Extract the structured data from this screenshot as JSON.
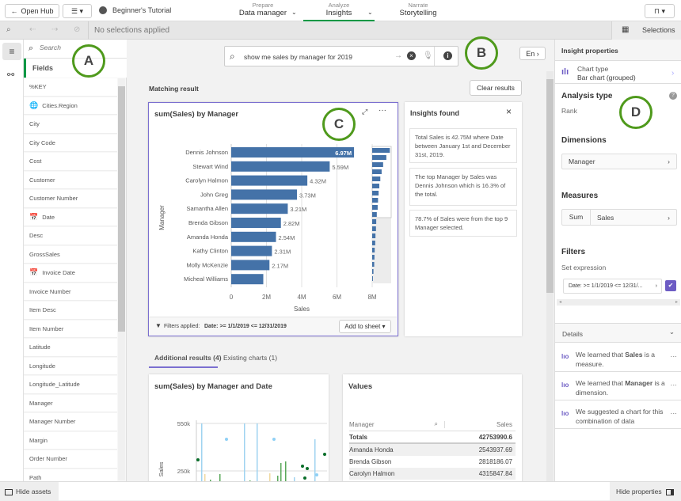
{
  "header": {
    "open_hub": "Open Hub",
    "app_name": "Beginner's Tutorial",
    "tabs": [
      {
        "small": "Prepare",
        "label": "Data manager"
      },
      {
        "small": "Analyze",
        "label": "Insights"
      },
      {
        "small": "Narrate",
        "label": "Storytelling"
      }
    ]
  },
  "toolbar": {
    "selections_status": "No selections applied",
    "selections_label": "Selections"
  },
  "assets": {
    "search_placeholder": "Search",
    "fields_tab": "Fields",
    "fields": [
      {
        "name": "%KEY",
        "icon": ""
      },
      {
        "name": "Cities.Region",
        "icon": "globe-icon"
      },
      {
        "name": "City",
        "icon": ""
      },
      {
        "name": "City Code",
        "icon": ""
      },
      {
        "name": "Cost",
        "icon": ""
      },
      {
        "name": "Customer",
        "icon": ""
      },
      {
        "name": "Customer Number",
        "icon": ""
      },
      {
        "name": "Date",
        "icon": "calendar-icon"
      },
      {
        "name": "Desc",
        "icon": ""
      },
      {
        "name": "GrossSales",
        "icon": ""
      },
      {
        "name": "Invoice Date",
        "icon": "calendar-icon"
      },
      {
        "name": "Invoice Number",
        "icon": ""
      },
      {
        "name": "Item Desc",
        "icon": ""
      },
      {
        "name": "Item Number",
        "icon": ""
      },
      {
        "name": "Latitude",
        "icon": ""
      },
      {
        "name": "Longitude",
        "icon": ""
      },
      {
        "name": "Longitude_Latitude",
        "icon": ""
      },
      {
        "name": "Manager",
        "icon": ""
      },
      {
        "name": "Manager Number",
        "icon": ""
      },
      {
        "name": "Margin",
        "icon": ""
      },
      {
        "name": "Order Number",
        "icon": ""
      },
      {
        "name": "Path",
        "icon": ""
      }
    ],
    "hide_assets": "Hide assets"
  },
  "search": {
    "query": "show me sales by manager for 2019",
    "language": "En"
  },
  "main": {
    "matching_result": "Matching result",
    "clear_results": "Clear results",
    "filters_applied_label": "Filters applied:",
    "filters_applied_value": "Date: >= 1/1/2019 <= 12/31/2019",
    "add_to_sheet": "Add to sheet",
    "tabs": [
      "Additional results (4)",
      "Existing charts (1)"
    ]
  },
  "insights": {
    "title": "Insights found",
    "items": [
      "Total Sales is 42.75M where Date between January 1st and December 31st, 2019.",
      "The top Manager by Sales was Dennis Johnson which is 16.3% of the total.",
      "78.7% of Sales were from the top 9 Manager selected."
    ]
  },
  "annotations": [
    "A",
    "B",
    "C",
    "D"
  ],
  "chart_data": [
    {
      "type": "bar",
      "orientation": "horizontal",
      "title": "sum(Sales) by Manager",
      "xlabel": "Sales",
      "ylabel": "Manager",
      "categories": [
        "Dennis Johnson",
        "Stewart Wind",
        "Carolyn Halmon",
        "John Greg",
        "Samantha Allen",
        "Brenda Gibson",
        "Amanda Honda",
        "Kathy Clinton",
        "Molly McKenzie",
        "Micheal Williams"
      ],
      "values": [
        6.97,
        5.59,
        4.32,
        3.73,
        3.21,
        2.82,
        2.54,
        2.31,
        2.17,
        1.82
      ],
      "labels": [
        "6.97M",
        "5.59M",
        "4.32M",
        "3.73M",
        "3.21M",
        "2.82M",
        "2.54M",
        "2.31M",
        "2.17M",
        ""
      ],
      "xlim": [
        0,
        8
      ],
      "xticks": [
        "0",
        "2M",
        "4M",
        "6M",
        "8M"
      ],
      "color": "#4472a8",
      "grid": true
    },
    {
      "type": "bar",
      "title": "sum(Sales) by Manager and Date",
      "ylabel": "Sales",
      "yticks": [
        "550k",
        "250k"
      ],
      "ylim": [
        0,
        600000
      ]
    },
    {
      "type": "table",
      "title": "Values",
      "columns": [
        "Manager",
        "Sales"
      ],
      "totals": [
        "Totals",
        "42753990.6"
      ],
      "rows": [
        [
          "Amanda Honda",
          "2543937.69"
        ],
        [
          "Brenda Gibson",
          "2818186.07"
        ],
        [
          "Carolyn Halmon",
          "4315847.84"
        ]
      ]
    }
  ],
  "properties": {
    "title": "Insight properties",
    "chart_type_label": "Chart type",
    "chart_type_value": "Bar chart (grouped)",
    "analysis_type_label": "Analysis type",
    "analysis_type_value": "Rank",
    "dimensions_label": "Dimensions",
    "dimension": "Manager",
    "measures_label": "Measures",
    "measure_agg": "Sum",
    "measure": "Sales",
    "filters_label": "Filters",
    "set_expression": "Set expression",
    "filter_value": "Date: >= 1/1/2019 <= 12/31/...",
    "details_label": "Details",
    "details": [
      [
        "We learned that ",
        "Sales",
        " is a measure."
      ],
      [
        "We learned that ",
        "Manager",
        " is a dimension."
      ],
      [
        "We suggested a chart for this combination of data",
        "",
        ""
      ]
    ],
    "hide_properties": "Hide properties",
    "accent": "#6d5cc4"
  }
}
